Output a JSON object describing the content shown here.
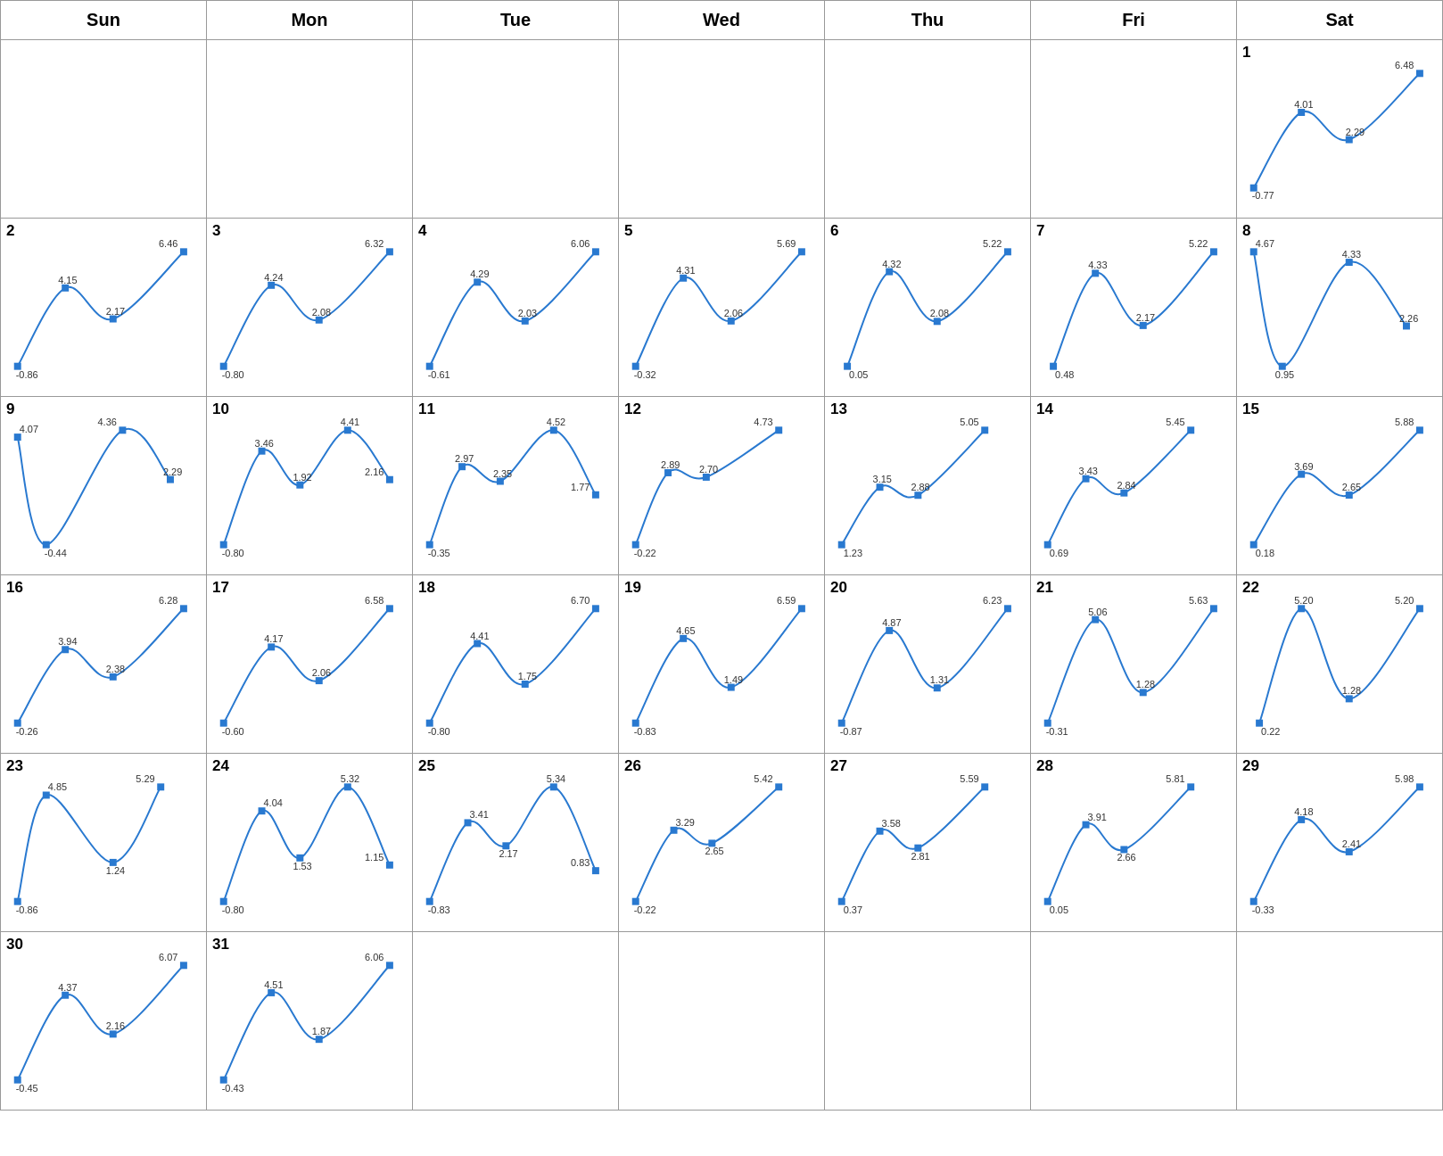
{
  "calendar": {
    "headers": [
      "Sun",
      "Mon",
      "Tue",
      "Wed",
      "Thu",
      "Fri",
      "Sat"
    ],
    "days": [
      {
        "day": null,
        "values": []
      },
      {
        "day": null,
        "values": []
      },
      {
        "day": null,
        "values": []
      },
      {
        "day": null,
        "values": []
      },
      {
        "day": null,
        "values": []
      },
      {
        "day": null,
        "values": []
      },
      {
        "day": 1,
        "values": [
          -0.77,
          4.01,
          2.29,
          6.48
        ]
      },
      {
        "day": 2,
        "values": [
          -0.86,
          4.15,
          2.17,
          6.46
        ]
      },
      {
        "day": 3,
        "values": [
          -0.8,
          4.24,
          2.08,
          6.32
        ]
      },
      {
        "day": 4,
        "values": [
          -0.61,
          4.29,
          2.03,
          6.06
        ]
      },
      {
        "day": 5,
        "values": [
          -0.32,
          4.31,
          2.06,
          5.69
        ]
      },
      {
        "day": 6,
        "values": [
          0.05,
          4.32,
          2.08,
          5.22
        ]
      },
      {
        "day": 7,
        "values": [
          0.48,
          4.33,
          2.17,
          5.22
        ]
      },
      {
        "day": 8,
        "values": [
          4.67,
          0.95,
          4.33,
          2.26
        ]
      },
      {
        "day": 9,
        "values": [
          -0.44,
          4.07,
          4.36,
          2.29
        ]
      },
      {
        "day": 10,
        "values": [
          -0.8,
          3.46,
          1.92,
          4.41,
          2.16
        ]
      },
      {
        "day": 11,
        "values": [
          -0.35,
          2.97,
          2.35,
          4.52,
          1.77
        ]
      },
      {
        "day": 12,
        "values": [
          -0.22,
          2.89,
          2.7,
          4.73
        ]
      },
      {
        "day": 13,
        "values": [
          1.23,
          3.15,
          2.88,
          5.05
        ]
      },
      {
        "day": 14,
        "values": [
          0.69,
          3.43,
          2.84,
          5.45
        ]
      },
      {
        "day": 15,
        "values": [
          0.18,
          3.69,
          2.65,
          5.88
        ]
      },
      {
        "day": 16,
        "values": [
          -0.26,
          3.94,
          2.38,
          6.28
        ]
      },
      {
        "day": 17,
        "values": [
          -0.6,
          4.17,
          2.06,
          6.58
        ]
      },
      {
        "day": 18,
        "values": [
          -0.8,
          4.41,
          1.75,
          6.7
        ]
      },
      {
        "day": 19,
        "values": [
          -0.83,
          4.65,
          1.49,
          6.59
        ]
      },
      {
        "day": 20,
        "values": [
          -0.87,
          4.87,
          1.31,
          6.23
        ]
      },
      {
        "day": 21,
        "values": [
          -0.31,
          5.06,
          1.28,
          5.63
        ]
      },
      {
        "day": 22,
        "values": [
          0.22,
          5.2,
          1.28,
          5.2
        ]
      },
      {
        "day": 23,
        "values": [
          -0.86,
          4.85,
          1.24,
          5.29
        ]
      },
      {
        "day": 24,
        "values": [
          -0.8,
          4.04,
          1.53,
          5.32,
          1.15
        ]
      },
      {
        "day": 25,
        "values": [
          -0.83,
          3.41,
          2.17,
          5.34,
          0.83
        ]
      },
      {
        "day": 26,
        "values": [
          -0.22,
          3.29,
          2.65,
          5.42
        ]
      },
      {
        "day": 27,
        "values": [
          0.37,
          3.58,
          2.81,
          5.59
        ]
      },
      {
        "day": 28,
        "values": [
          0.05,
          3.91,
          2.66,
          5.81
        ]
      },
      {
        "day": 29,
        "values": [
          -0.33,
          4.18,
          2.41,
          5.98
        ]
      },
      {
        "day": 30,
        "values": [
          -0.45,
          4.37,
          2.16,
          6.07
        ]
      },
      {
        "day": 31,
        "values": [
          -0.43,
          4.51,
          1.87,
          6.06
        ]
      }
    ]
  }
}
